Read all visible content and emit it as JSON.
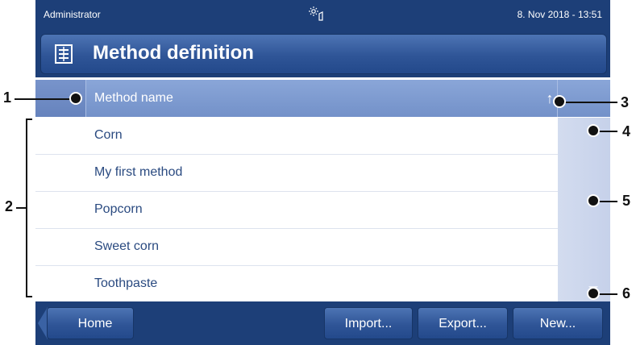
{
  "status": {
    "user": "Administrator",
    "datetime": "8. Nov 2018 - 13:51",
    "icon": "brightness-touch-icon"
  },
  "title": {
    "text": "Method definition",
    "icon": "method-list-icon"
  },
  "list": {
    "column_header": "Method name",
    "sort_glyph": "↑",
    "rows": [
      "Corn",
      "My first method",
      "Popcorn",
      "Sweet corn",
      "Toothpaste"
    ]
  },
  "footer": {
    "home": "Home",
    "import": "Import...",
    "export": "Export...",
    "new": "New..."
  },
  "callouts": {
    "c1": "1",
    "c2": "2",
    "c3": "3",
    "c4": "4",
    "c5": "5",
    "c6": "6"
  },
  "colors": {
    "bar_dark": "#1d3f78",
    "button_blue": "#2f5597",
    "header_blue": "#7f9cd2",
    "text_blue": "#2a4a80"
  }
}
